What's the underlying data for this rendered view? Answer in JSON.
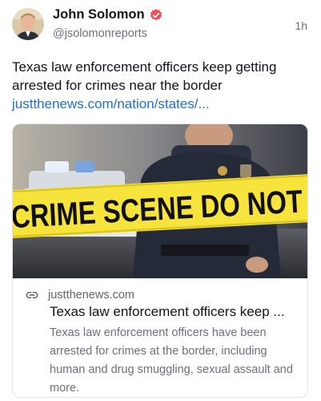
{
  "post": {
    "author_name": "John Solomon",
    "author_handle": "@jsolomonreports",
    "timestamp": "1h",
    "text": "Texas law enforcement officers keep getting arrested for crimes near the border",
    "link_text": "justthenews.com/nation/states/...",
    "verified_icon": "verified-badge-icon",
    "verified_color": "#ec4f55"
  },
  "card": {
    "tape_text": "CRIME SCENE DO NOT CR",
    "domain": "justthenews.com",
    "title": "Texas law enforcement officers keep ...",
    "description": "Texas law enforcement officers have been arrested for crimes at the border, including human and drug smuggling, sexual assault and more.",
    "link_icon": "link-icon",
    "tape_color": "#f6e33c"
  },
  "colors": {
    "text": "#111318",
    "muted": "#6b7079",
    "link": "#1f6fd0"
  }
}
